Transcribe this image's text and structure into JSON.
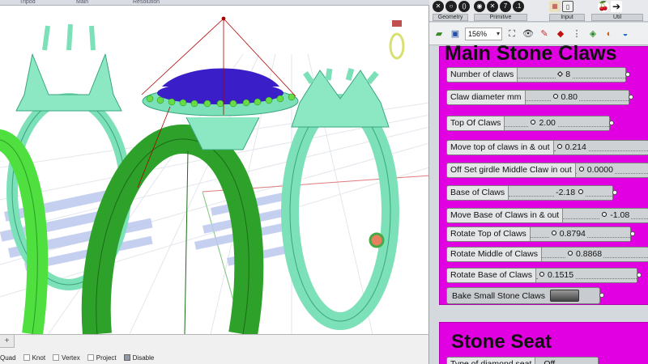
{
  "viewport": {
    "top_tabs": [
      "Tripod",
      "Main",
      "Resolution"
    ],
    "bottom": {
      "add_tab": "+",
      "osnaps": [
        {
          "label": "Quad",
          "checked": false
        },
        {
          "label": "Knot",
          "checked": false
        },
        {
          "label": "Vertex",
          "checked": false
        },
        {
          "label": "Project",
          "checked": false
        },
        {
          "label": "Disable",
          "checked": true
        }
      ]
    },
    "colors": {
      "ring_bright": "#55ee44",
      "ring_dark": "#229922",
      "ring_mint": "#7ce0b8",
      "stone": "#3a1fc8",
      "background": "#ffffff"
    }
  },
  "grasshopper": {
    "ribbon": [
      {
        "label": "Geometry",
        "icons": [
          "x-icon",
          "circle-icon",
          "parenthesis-icon",
          "arrow-icon"
        ]
      },
      {
        "label": "Primitive",
        "icons": [
          "eye-icon",
          "x-icon",
          "7-icon",
          "0.1-icon"
        ]
      },
      {
        "label": "Input",
        "icons": [
          "grid-icon",
          "slider-icon"
        ]
      },
      {
        "label": "Util",
        "icons": [
          "cherry-icon",
          "arrow-right-icon"
        ]
      }
    ],
    "toolbar": {
      "zoom": "156%"
    },
    "groups": {
      "main": {
        "title": "Main Stone Claws",
        "sliders": [
          {
            "label": "Number of claws",
            "value": "8"
          },
          {
            "label": "Claw diameter mm",
            "value": "0.80"
          },
          {
            "label": "Top Of Claws",
            "value": "2.00"
          },
          {
            "label": "Move top of claws  in & out",
            "value": "0.214"
          },
          {
            "label": "Off Set girdle Middle Claw in out",
            "value": "0.0000"
          },
          {
            "label": "Base of Claws",
            "value": "-2.18"
          },
          {
            "label": "Move Base of Claws in & out",
            "value": "-1.08"
          },
          {
            "label": "Rotate Top of Claws",
            "value": "0.8794"
          },
          {
            "label": "Rotate Middle of  Claws",
            "value": "0.8868"
          },
          {
            "label": "Rotate Base of Claws",
            "value": "0.1515"
          }
        ],
        "button": {
          "label": "Bake Small Stone Claws"
        }
      },
      "seat": {
        "title": "Stone Seat",
        "partial_label": "Type of diamond seat",
        "partial_value": "Off"
      }
    },
    "colors": {
      "group": "#e100e1",
      "canvas": "#d4d9de"
    }
  }
}
